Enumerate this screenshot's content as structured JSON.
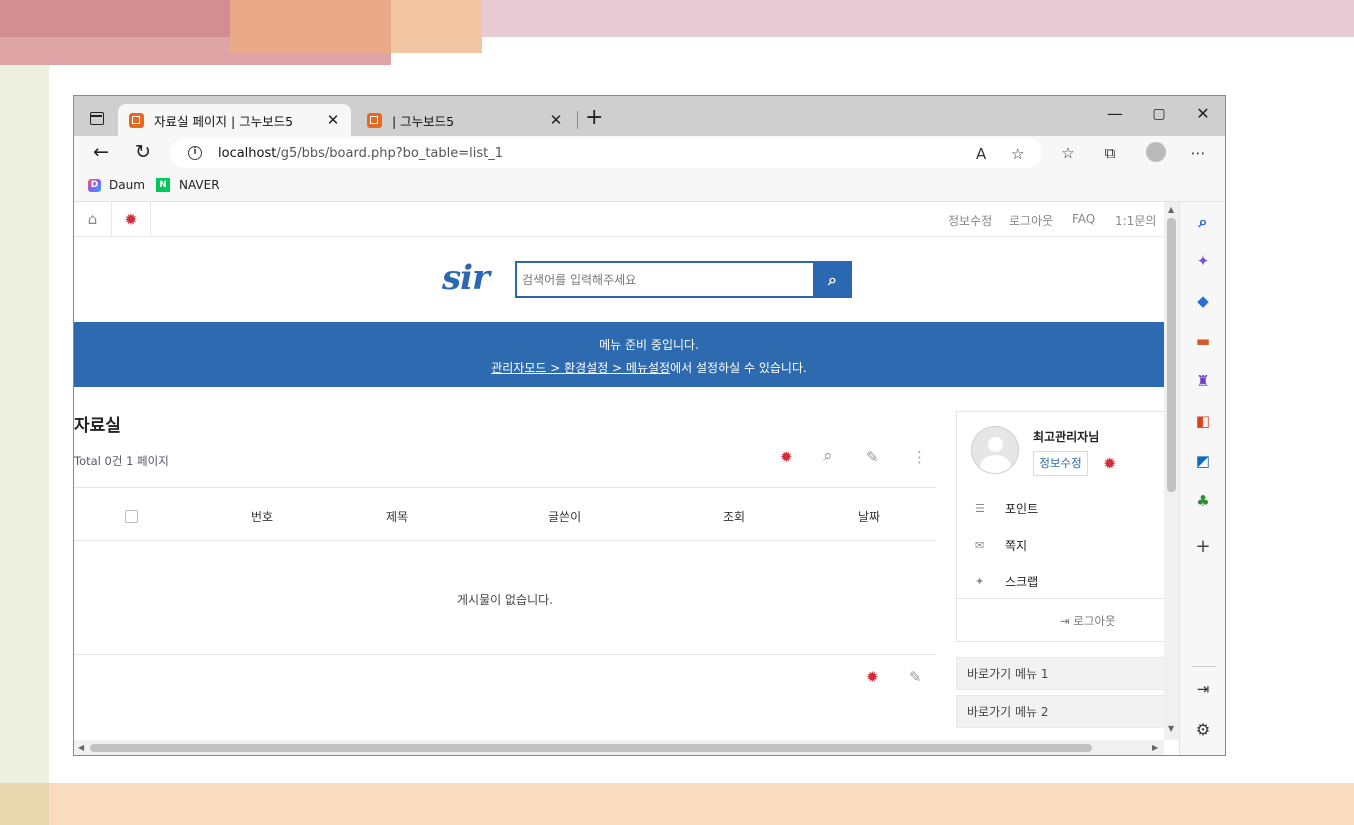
{
  "colors": {
    "brand_blue": "#2d6ab0",
    "accent_red": "#d12d3a",
    "titlebar_gray": "#cfcfcf"
  },
  "browser": {
    "tabs": [
      {
        "title": "자료실 페이지 | 그누보드5",
        "active": true
      },
      {
        "title": "| 그누보드5",
        "active": false
      }
    ],
    "url_host": "localhost",
    "url_path": "/g5/bbs/board.php?bo_table=list_1",
    "bookmarks": [
      {
        "label": "Daum",
        "icon": "daum-logo-icon"
      },
      {
        "label": "NAVER",
        "icon": "naver-logo-icon"
      }
    ]
  },
  "site": {
    "gnb_links": [
      "정보수정",
      "로그아웃",
      "FAQ",
      "1:1문의"
    ],
    "logo_text": "sir",
    "search_placeholder": "검색어를 입력해주세요",
    "menu_notice_line1": "메뉴 준비 중입니다.",
    "menu_notice_link": "관리자모드 > 환경설정 > 메뉴설정",
    "menu_notice_tail": "에서 설정하실 수 있습니다."
  },
  "board": {
    "title": "자료실",
    "total": "Total 0건 1 페이지",
    "columns": [
      "번호",
      "제목",
      "글쓴이",
      "조회",
      "날짜"
    ],
    "empty_message": "게시물이 없습니다."
  },
  "sidebox": {
    "name": "최고관리자님",
    "edit_label": "정보수정",
    "items": [
      {
        "label": "포인트",
        "icon": "database-icon"
      },
      {
        "label": "쪽지",
        "icon": "envelope-icon"
      },
      {
        "label": "스크랩",
        "icon": "pin-icon"
      }
    ],
    "logout_label": "로그아웃",
    "quick_menus": [
      "바로가기 메뉴 1",
      "바로가기 메뉴 2"
    ]
  }
}
